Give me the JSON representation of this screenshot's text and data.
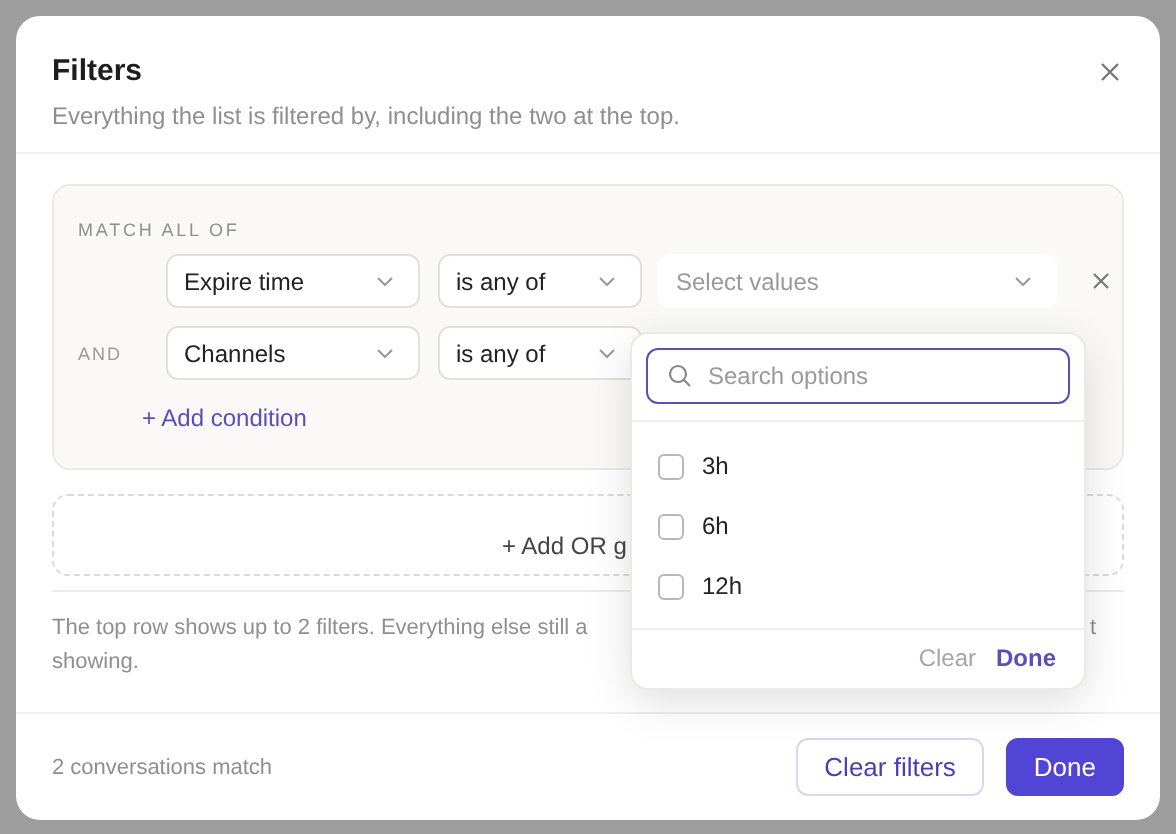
{
  "dialog": {
    "title": "Filters",
    "subtitle": "Everything the list is filtered by, including the two at the top."
  },
  "match_group": {
    "label": "MATCH ALL OF",
    "conditions": [
      {
        "field": "Expire time",
        "operator": "is any of",
        "value_placeholder": "Select values",
        "removable": true
      },
      {
        "conjunction": "AND",
        "field": "Channels",
        "operator": "is any of"
      }
    ],
    "add_condition": "+ Add condition"
  },
  "add_or_group": "+ Add OR g",
  "note": {
    "line_1": "The top row shows up to 2 filters. Everything else still a",
    "line_1_end": "t",
    "line_2": "showing."
  },
  "footer": {
    "match_count": "2 conversations match",
    "buttons": [
      {
        "label": "Clear filters",
        "kind": "secondary"
      },
      {
        "label": "Done",
        "kind": "primary"
      }
    ]
  },
  "values_popover": {
    "search": {
      "placeholder": "Search options"
    },
    "options": [
      {
        "label": "3h",
        "checked": false
      },
      {
        "label": "6h",
        "checked": false
      },
      {
        "label": "12h",
        "checked": false
      }
    ],
    "clear": "Clear",
    "done": "Done"
  }
}
